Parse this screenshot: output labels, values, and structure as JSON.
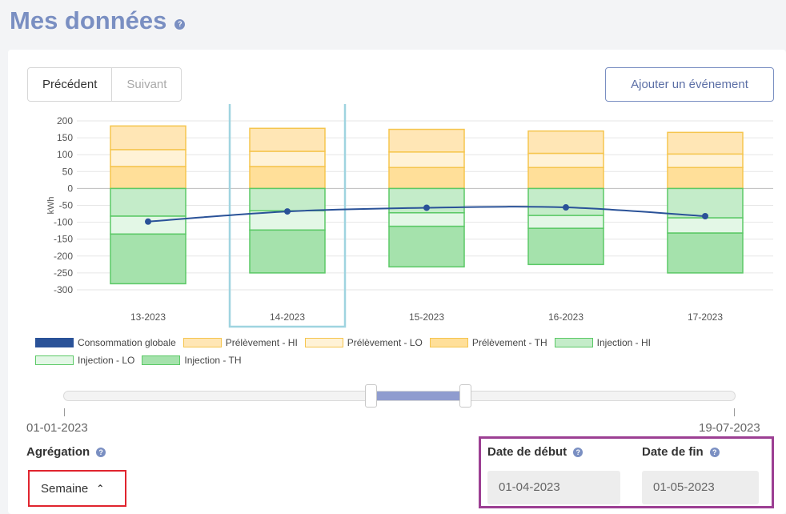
{
  "header": {
    "title": "Mes données",
    "help_icon": "question-circle-icon"
  },
  "nav": {
    "prev_label": "Précédent",
    "next_label": "Suivant"
  },
  "event_button_label": "Ajouter un événement",
  "chart_data": {
    "type": "bar",
    "stacked": true,
    "ylabel": "kWh",
    "ylim": [
      -300,
      200
    ],
    "yticks": [
      200,
      150,
      100,
      50,
      0,
      -50,
      -100,
      -150,
      -200,
      -250,
      -300
    ],
    "categories": [
      "13-2023",
      "14-2023",
      "15-2023",
      "16-2023",
      "17-2023"
    ],
    "highlighted_category": "14-2023",
    "series": [
      {
        "name": "Prélèvement - TH",
        "type": "bar",
        "color": "#ffdf99",
        "border": "#f5c54e",
        "values": [
          65,
          65,
          62,
          62,
          62
        ]
      },
      {
        "name": "Prélèvement - LO",
        "type": "bar",
        "color": "#fff2d6",
        "border": "#f5c54e",
        "values": [
          50,
          45,
          46,
          42,
          40
        ]
      },
      {
        "name": "Prélèvement - HI",
        "type": "bar",
        "color": "#ffe6b5",
        "border": "#f5c54e",
        "values": [
          70,
          68,
          67,
          66,
          64
        ]
      },
      {
        "name": "Injection - HI",
        "type": "bar",
        "color": "#c4ecc9",
        "border": "#5bc966",
        "values": [
          -82,
          -66,
          -72,
          -80,
          -87
        ]
      },
      {
        "name": "Injection - LO",
        "type": "bar",
        "color": "#e3f7e6",
        "border": "#5bc966",
        "values": [
          -53,
          -57,
          -40,
          -38,
          -45
        ]
      },
      {
        "name": "Injection - TH",
        "type": "bar",
        "color": "#a5e2ac",
        "border": "#5bc966",
        "values": [
          -147,
          -127,
          -120,
          -107,
          -118
        ]
      },
      {
        "name": "Consommation globale",
        "type": "line",
        "color": "#2a5298",
        "values": [
          -98,
          -68,
          -57,
          -56,
          -82
        ]
      }
    ],
    "legend_order": [
      "Consommation globale",
      "Prélèvement - HI",
      "Prélèvement - LO",
      "Prélèvement - TH",
      "Injection - HI",
      "Injection - LO",
      "Injection - TH"
    ]
  },
  "slider": {
    "min_label": "01-01-2023",
    "max_label": "19-07-2023"
  },
  "aggregation": {
    "label": "Agrégation",
    "value": "Semaine",
    "caret": "^"
  },
  "dates": {
    "start_label": "Date de début",
    "start_value": "01-04-2023",
    "end_label": "Date de fin",
    "end_value": "01-05-2023"
  }
}
